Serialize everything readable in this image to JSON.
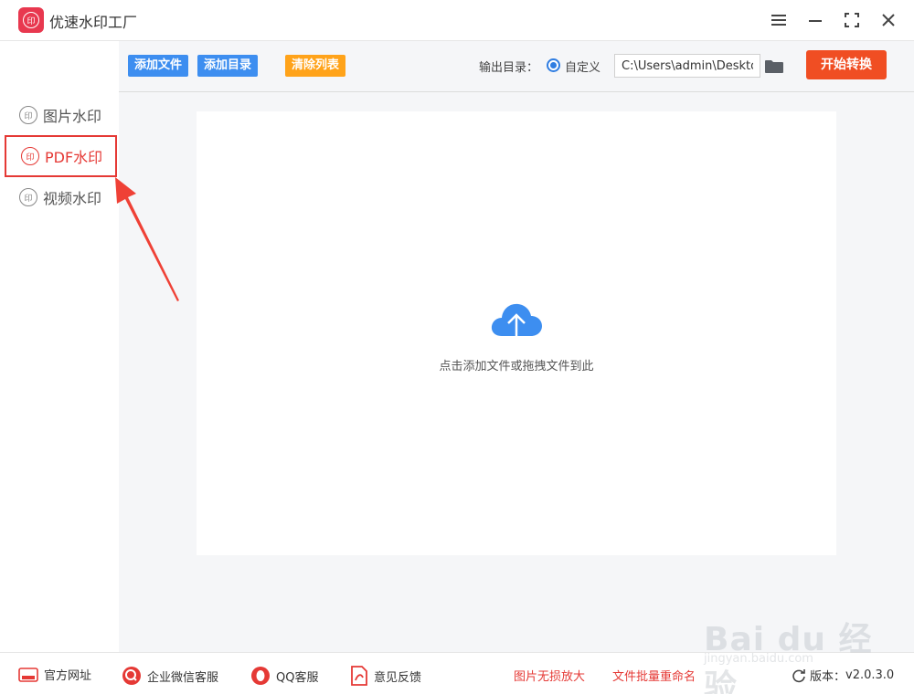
{
  "app": {
    "title": "优速水印工厂",
    "logo_text": "印"
  },
  "window_controls": {
    "menu_icon": "menu-icon",
    "minimize_icon": "minimize-icon",
    "maximize_icon": "maximize-icon",
    "close_icon": "close-icon"
  },
  "sidebar": {
    "items": [
      {
        "label": "图片水印",
        "icon": "印",
        "active": false
      },
      {
        "label": "PDF水印",
        "icon": "印",
        "active": true
      },
      {
        "label": "视频水印",
        "icon": "印",
        "active": false
      }
    ]
  },
  "toolbar": {
    "add_file": "添加文件",
    "add_dir": "添加目录",
    "clear_list": "清除列表",
    "output_label": "输出目录：",
    "radio_label": "自定义",
    "output_path": "C:\\Users\\admin\\Deskto",
    "start": "开始转换"
  },
  "drop_zone": {
    "text": "点击添加文件或拖拽文件到此"
  },
  "footer": {
    "website": "官方网址",
    "wechat": "企业微信客服",
    "qq": "QQ客服",
    "feedback": "意见反馈",
    "image_enlarge": "图片无损放大",
    "batch_rename": "文件批量重命名",
    "version_label": "版本：",
    "version": "v2.0.3.0"
  },
  "watermark": {
    "main": "Bai du 经验",
    "sub": "jingyan.baidu.com"
  },
  "colors": {
    "accent_red": "#e53935",
    "button_blue": "#3d8ef0",
    "button_orange": "#ffa31a",
    "start_button": "#f04e23",
    "cloud_blue": "#3d8ef0"
  }
}
